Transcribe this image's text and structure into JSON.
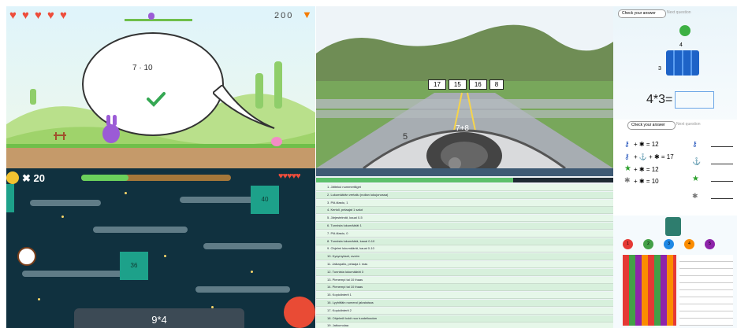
{
  "runner": {
    "hearts": 5,
    "score": "200",
    "equation": "7 · 10",
    "colors": {
      "heart": "#ee4d3b",
      "bunny": "#9b5bd6",
      "check": "#35a853"
    }
  },
  "racing": {
    "answers": [
      "17",
      "15",
      "16",
      "8"
    ],
    "dash_equation": "7+8",
    "speed": "5"
  },
  "arrays_app": {
    "tab_active": "Check your answer",
    "tab_inactive": "Next question",
    "top_number": "4",
    "side_number": "3",
    "equation": "4*3="
  },
  "symbol_app": {
    "tab_active": "Check your answer",
    "tab_inactive": "Next question",
    "equations": [
      {
        "text": "+ ✱ = 12"
      },
      {
        "text": "+ ⚓ + ✱ = 17"
      },
      {
        "text": "+ ✱ = 12"
      },
      {
        "text": "+ ✱ = 10"
      }
    ]
  },
  "space": {
    "score": "20",
    "hearts": 5,
    "tiles": [
      "40",
      "36"
    ],
    "equation": "9*4"
  },
  "table_app": {
    "rows": [
      "1. Jättekul nummertåget",
      "2. Lukumäärän vertailu (nollan lukujonossa)",
      "3. Pöl-tilasto, 1",
      "4. Kertoli, pelaajat 1 salut",
      "5. Järjestelmät, kauai 0-5",
      "6. Tunnista lukumäärät 1",
      "7. Pöl-tilasto, 0",
      "8. Tunnista lukumäärä, kauai 0-10",
      "9. Ohjelmi lukumäärät, kauai 0-10",
      "10. Kysymykset, avoim",
      "11. Jalkapallo, pelaaja 1 mas",
      "12. Tunnista lukumäärät 3",
      "13. Pienempi tai 10 thaas",
      "14. Pienempi tai 10 thaas",
      "15. Kopiolinterit 1",
      "16. Lyyhittäin numeroi jalostaisas",
      "17. Kopiolinterit 2",
      "18. Ohjelmili kokit nuo tuodellusdan",
      "19. Jatkumolaa"
    ]
  },
  "pattern_app": {
    "circle_labels": [
      "1",
      "2",
      "3",
      "4",
      "5"
    ],
    "colors": [
      "#e53935",
      "#43a047",
      "#1e88e5",
      "#fb8c00",
      "#8e24aa"
    ]
  }
}
